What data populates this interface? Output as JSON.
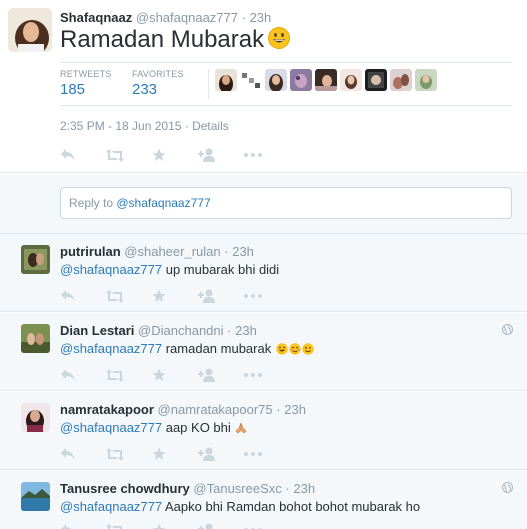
{
  "main_tweet": {
    "fullname": "Shafaqnaaz",
    "handle": "@shafaqnaaz777",
    "separator": "·",
    "time": "23h",
    "text": "Ramadan Mubarak",
    "retweets_label": "RETWEETS",
    "retweets_count": "185",
    "favorites_label": "FAVORITES",
    "favorites_count": "233",
    "timestamp": "2:35 PM - 18 Jun 2015 · Details"
  },
  "reply_box": {
    "prefix": "Reply to ",
    "handle": "@shafaqnaaz777"
  },
  "replies": [
    {
      "fullname": "putrirulan",
      "handle": "@shaheer_rulan",
      "separator": "·",
      "time": "23h",
      "mention": "@shafaqnaaz777",
      "text": " up mubarak bhi didi"
    },
    {
      "fullname": "Dian Lestari",
      "handle": "@Dianchandni",
      "separator": "·",
      "time": "23h",
      "mention": "@shafaqnaaz777",
      "text": " ramadan mubarak"
    },
    {
      "fullname": "namratakapoor",
      "handle": "@namratakapoor75",
      "separator": "·",
      "time": "23h",
      "mention": "@shafaqnaaz777",
      "text": " aap KO bhi"
    },
    {
      "fullname": "Tanusree chowdhury",
      "handle": "@TanusreeSxc",
      "separator": "·",
      "time": "23h",
      "mention": "@shafaqnaaz777",
      "text": " Aapko bhi Ramdan bohot bohot mubarak ho"
    }
  ],
  "colors": {
    "link": "#2b7bb9",
    "muted": "#8899a6",
    "text": "#292f33",
    "icon": "#ccd6dd",
    "bg_alt": "#f5f8fa"
  },
  "icons": [
    "reply-icon",
    "retweet-icon",
    "favorite-star-icon",
    "follow-icon",
    "more-icon",
    "globe-icon",
    "smiley-icon"
  ]
}
